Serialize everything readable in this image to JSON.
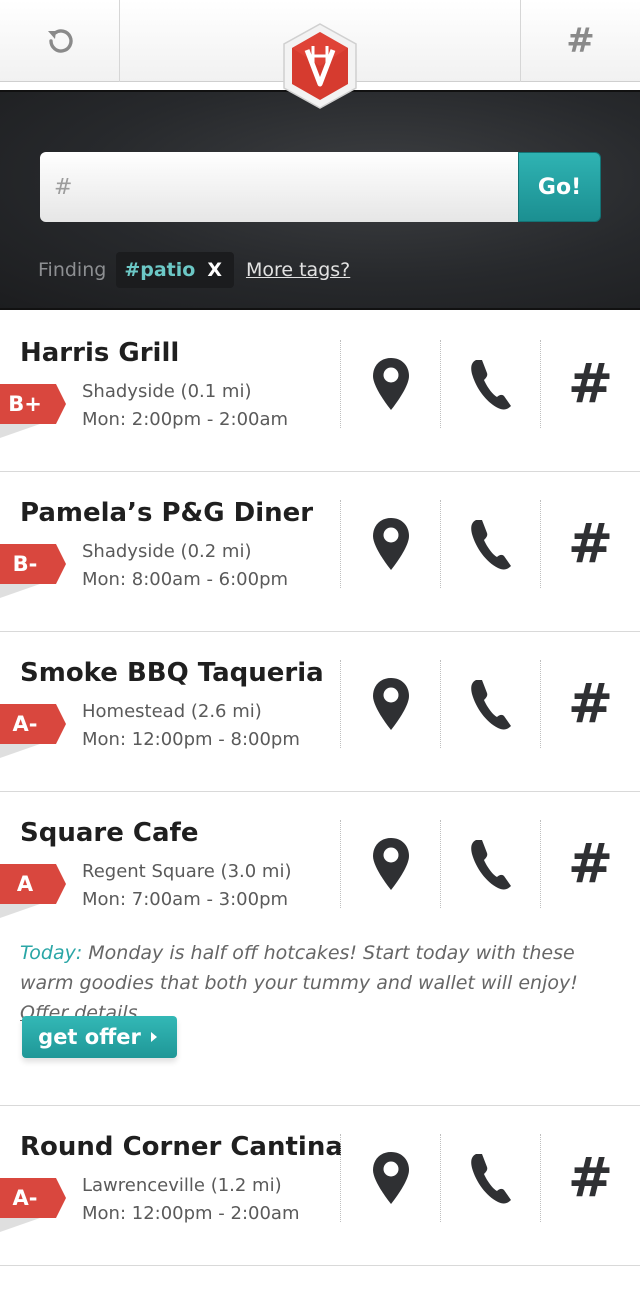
{
  "topbar": {
    "refresh_icon": "refresh-icon",
    "hashtag_label": "#",
    "logo_icon": "shield-logo-icon"
  },
  "search": {
    "placeholder": "#",
    "go_label": "Go!",
    "finding_label": "Finding",
    "active_tag": "#patio",
    "remove_tag_label": "X",
    "more_tags_label": "More tags?"
  },
  "colors": {
    "accent": "#23a3a4",
    "grade_red": "#d9473e",
    "dark_bg": "#27292c"
  },
  "listings": [
    {
      "name": "Harris Grill",
      "grade": "B+",
      "location": "Shadyside (0.1 mi)",
      "hours": "Mon: 2:00pm - 2:00am",
      "hashtag_label": "#"
    },
    {
      "name": "Pamela’s P&G Diner",
      "grade": "B-",
      "location": "Shadyside (0.2 mi)",
      "hours": "Mon: 8:00am - 6:00pm",
      "hashtag_label": "#"
    },
    {
      "name": "Smoke BBQ Taqueria",
      "grade": "A-",
      "location": "Homestead (2.6 mi)",
      "hours": "Mon: 12:00pm - 8:00pm",
      "hashtag_label": "#"
    },
    {
      "name": "Square Cafe",
      "grade": "A",
      "location": "Regent Square (3.0 mi)",
      "hours": "Mon: 7:00am - 3:00pm",
      "hashtag_label": "#",
      "offer": {
        "today_label": "Today:",
        "text": " Monday is half off hotcakes! Start today with these warm goodies that both your tummy and wallet will enjoy! ",
        "details_label": "Offer details",
        "button_label": "get offer"
      }
    },
    {
      "name": "Round Corner Cantina",
      "grade": "A-",
      "location": "Lawrenceville (1.2 mi)",
      "hours": "Mon: 12:00pm - 2:00am",
      "hashtag_label": "#"
    }
  ]
}
